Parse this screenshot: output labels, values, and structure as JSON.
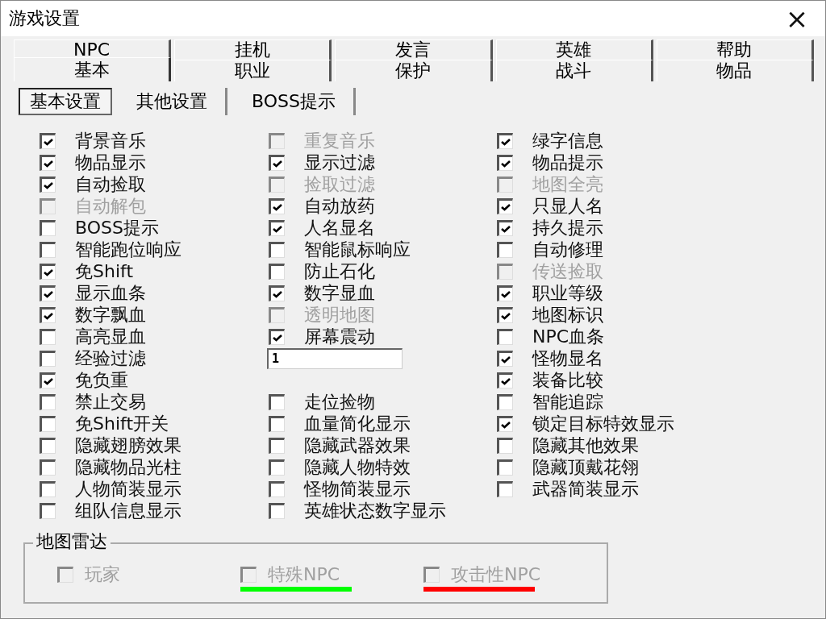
{
  "window": {
    "title": "游戏设置",
    "close": "×"
  },
  "tabs": {
    "back_row": [
      {
        "label": "NPC",
        "selected": false
      },
      {
        "label": "挂机",
        "selected": false
      },
      {
        "label": "发言",
        "selected": false
      },
      {
        "label": "英雄",
        "selected": false
      },
      {
        "label": "帮助",
        "selected": false
      }
    ],
    "front_row": [
      {
        "label": "基本",
        "selected": true
      },
      {
        "label": "职业",
        "selected": false
      },
      {
        "label": "保护",
        "selected": false
      },
      {
        "label": "战斗",
        "selected": false
      },
      {
        "label": "物品",
        "selected": false
      }
    ]
  },
  "subtabs": [
    {
      "label": "基本设置",
      "selected": true
    },
    {
      "label": "其他设置",
      "selected": false
    },
    {
      "label": "BOSS提示",
      "selected": false
    }
  ],
  "columns": [
    [
      {
        "kind": "checkbox",
        "label": "背景音乐",
        "checked": true,
        "disabled": false
      },
      {
        "kind": "checkbox",
        "label": "物品显示",
        "checked": true,
        "disabled": false
      },
      {
        "kind": "checkbox",
        "label": "自动捡取",
        "checked": true,
        "disabled": false
      },
      {
        "kind": "checkbox",
        "label": "自动解包",
        "checked": false,
        "disabled": true
      },
      {
        "kind": "checkbox",
        "label": "BOSS提示",
        "checked": false,
        "disabled": false
      },
      {
        "kind": "checkbox",
        "label": "智能跑位响应",
        "checked": false,
        "disabled": false
      },
      {
        "kind": "checkbox",
        "label": "免Shift",
        "checked": true,
        "disabled": false
      },
      {
        "kind": "checkbox",
        "label": "显示血条",
        "checked": true,
        "disabled": false
      },
      {
        "kind": "checkbox",
        "label": "数字飘血",
        "checked": true,
        "disabled": false
      },
      {
        "kind": "checkbox",
        "label": "高亮显血",
        "checked": false,
        "disabled": false
      },
      {
        "kind": "checkbox",
        "label": "经验过滤",
        "checked": false,
        "disabled": false
      },
      {
        "kind": "checkbox",
        "label": "免负重",
        "checked": true,
        "disabled": false
      },
      {
        "kind": "checkbox",
        "label": "禁止交易",
        "checked": false,
        "disabled": false
      },
      {
        "kind": "checkbox",
        "label": "免Shift开关",
        "checked": false,
        "disabled": false
      },
      {
        "kind": "checkbox",
        "label": "隐藏翅膀效果",
        "checked": false,
        "disabled": false
      },
      {
        "kind": "checkbox",
        "label": "隐藏物品光柱",
        "checked": false,
        "disabled": false
      },
      {
        "kind": "checkbox",
        "label": "人物简装显示",
        "checked": false,
        "disabled": false
      },
      {
        "kind": "checkbox",
        "label": "组队信息显示",
        "checked": false,
        "disabled": false
      }
    ],
    [
      {
        "kind": "checkbox",
        "label": "重复音乐",
        "checked": false,
        "disabled": true
      },
      {
        "kind": "checkbox",
        "label": "显示过滤",
        "checked": true,
        "disabled": false
      },
      {
        "kind": "checkbox",
        "label": "捡取过滤",
        "checked": false,
        "disabled": true
      },
      {
        "kind": "checkbox",
        "label": "自动放药",
        "checked": true,
        "disabled": false
      },
      {
        "kind": "checkbox",
        "label": "人名显名",
        "checked": true,
        "disabled": false
      },
      {
        "kind": "checkbox",
        "label": "智能鼠标响应",
        "checked": false,
        "disabled": false
      },
      {
        "kind": "checkbox",
        "label": "防止石化",
        "checked": false,
        "disabled": false
      },
      {
        "kind": "checkbox",
        "label": "数字显血",
        "checked": true,
        "disabled": false
      },
      {
        "kind": "checkbox",
        "label": "透明地图",
        "checked": false,
        "disabled": true
      },
      {
        "kind": "checkbox",
        "label": "屏幕震动",
        "checked": true,
        "disabled": false
      },
      {
        "kind": "input",
        "value": "1"
      },
      {
        "kind": "blank"
      },
      {
        "kind": "checkbox",
        "label": "走位捡物",
        "checked": false,
        "disabled": false
      },
      {
        "kind": "checkbox",
        "label": "血量简化显示",
        "checked": false,
        "disabled": false
      },
      {
        "kind": "checkbox",
        "label": "隐藏武器效果",
        "checked": false,
        "disabled": false
      },
      {
        "kind": "checkbox",
        "label": "隐藏人物特效",
        "checked": false,
        "disabled": false
      },
      {
        "kind": "checkbox",
        "label": "怪物简装显示",
        "checked": false,
        "disabled": false
      },
      {
        "kind": "checkbox",
        "label": "英雄状态数字显示",
        "checked": false,
        "disabled": false
      }
    ],
    [
      {
        "kind": "checkbox",
        "label": "绿字信息",
        "checked": true,
        "disabled": false
      },
      {
        "kind": "checkbox",
        "label": "物品提示",
        "checked": true,
        "disabled": false
      },
      {
        "kind": "checkbox",
        "label": "地图全亮",
        "checked": false,
        "disabled": true
      },
      {
        "kind": "checkbox",
        "label": "只显人名",
        "checked": true,
        "disabled": false
      },
      {
        "kind": "checkbox",
        "label": "持久提示",
        "checked": true,
        "disabled": false
      },
      {
        "kind": "checkbox",
        "label": "自动修理",
        "checked": false,
        "disabled": false
      },
      {
        "kind": "checkbox",
        "label": "传送捡取",
        "checked": false,
        "disabled": true
      },
      {
        "kind": "checkbox",
        "label": "职业等级",
        "checked": true,
        "disabled": false
      },
      {
        "kind": "checkbox",
        "label": "地图标识",
        "checked": true,
        "disabled": false
      },
      {
        "kind": "checkbox",
        "label": "NPC血条",
        "checked": false,
        "disabled": false
      },
      {
        "kind": "checkbox",
        "label": "怪物显名",
        "checked": true,
        "disabled": false
      },
      {
        "kind": "checkbox",
        "label": "装备比较",
        "checked": true,
        "disabled": false
      },
      {
        "kind": "checkbox",
        "label": "智能追踪",
        "checked": false,
        "disabled": false
      },
      {
        "kind": "checkbox",
        "label": "锁定目标特效显示",
        "checked": true,
        "disabled": false
      },
      {
        "kind": "checkbox",
        "label": "隐藏其他效果",
        "checked": false,
        "disabled": false
      },
      {
        "kind": "checkbox",
        "label": "隐藏顶戴花翎",
        "checked": false,
        "disabled": false
      },
      {
        "kind": "checkbox",
        "label": "武器简装显示",
        "checked": false,
        "disabled": false
      }
    ]
  ],
  "map_radar": {
    "title": "地图雷达",
    "items": [
      {
        "label": "玩家",
        "checked": false,
        "disabled": true
      },
      {
        "label": "特殊NPC",
        "checked": false,
        "disabled": true,
        "color": "#00ff00"
      },
      {
        "label": "攻击性NPC",
        "checked": false,
        "disabled": true,
        "color": "#ff0000"
      }
    ]
  }
}
